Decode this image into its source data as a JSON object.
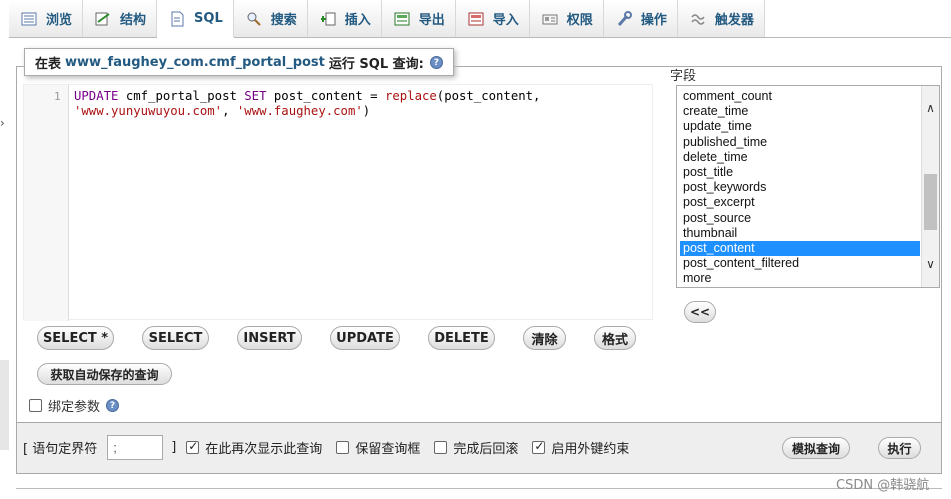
{
  "tabs": [
    {
      "label": "浏览",
      "icon": "browse-icon"
    },
    {
      "label": "结构",
      "icon": "structure-icon"
    },
    {
      "label": "SQL",
      "icon": "sql-icon"
    },
    {
      "label": "搜索",
      "icon": "search-icon"
    },
    {
      "label": "插入",
      "icon": "insert-icon"
    },
    {
      "label": "导出",
      "icon": "export-icon"
    },
    {
      "label": "导入",
      "icon": "import-icon"
    },
    {
      "label": "权限",
      "icon": "privileges-icon"
    },
    {
      "label": "操作",
      "icon": "operations-icon"
    },
    {
      "label": "触发器",
      "icon": "triggers-icon"
    }
  ],
  "active_tab": "SQL",
  "legend": {
    "prefix": "在表",
    "table_name": "www_faughey_com.cmf_portal_post",
    "suffix": "运行 SQL 查询:"
  },
  "editor": {
    "line_number": "1",
    "line1_kw1": "UPDATE",
    "line1_table": " cmf_portal_post ",
    "line1_kw2": "SET",
    "line1_col": " post_content = ",
    "line1_fn": "replace",
    "line1_args": "(post_content,",
    "line2_str1": "'www.yunyuwuyou.com'",
    "line2_sep": ", ",
    "line2_str2": "'www.faughey.com'",
    "line2_end": ")"
  },
  "fields": {
    "label": "字段",
    "items": [
      "comment_count",
      "create_time",
      "update_time",
      "published_time",
      "delete_time",
      "post_title",
      "post_keywords",
      "post_excerpt",
      "post_source",
      "thumbnail",
      "post_content",
      "post_content_filtered",
      "more"
    ],
    "selected": "post_content",
    "insert_button": "<<"
  },
  "query_buttons": {
    "select_star": "SELECT *",
    "select": "SELECT",
    "insert": "INSERT",
    "update": "UPDATE",
    "delete": "DELETE",
    "clear": "清除",
    "format": "格式",
    "get_autosaved": "获取自动保存的查询"
  },
  "bind_params": {
    "label": "绑定参数",
    "checked": false
  },
  "bottom": {
    "delimiter_open": "[ 语句定界符",
    "delimiter_value": ";",
    "delimiter_close": "]",
    "show_again": {
      "label": "在此再次显示此查询",
      "checked": true
    },
    "retain_box": {
      "label": "保留查询框",
      "checked": false
    },
    "rollback": {
      "label": "完成后回滚",
      "checked": false
    },
    "foreign_keys": {
      "label": "启用外键约束",
      "checked": true
    },
    "simulate_button": "模拟查询",
    "go_button": "执行"
  },
  "watermark": "CSDN @韩骁航"
}
